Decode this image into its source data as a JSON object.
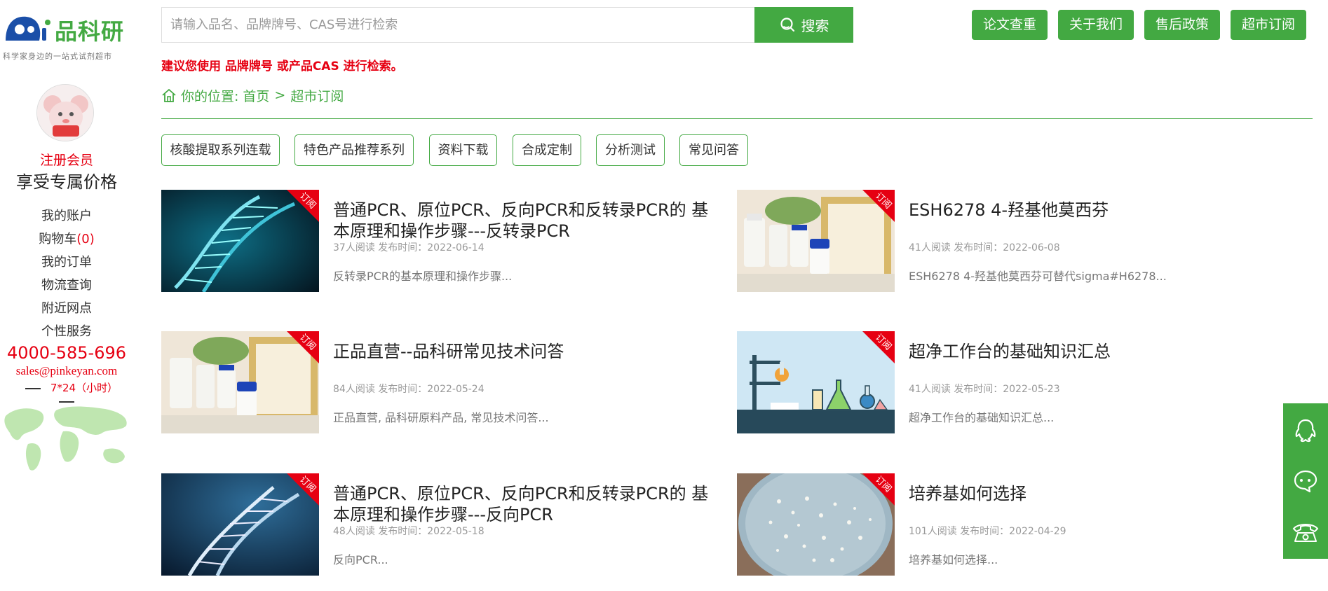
{
  "logo": {
    "text": "品科研",
    "slogan": "科学家身边的一站式试剂超市"
  },
  "sidebar": {
    "register": "注册会员",
    "price_tag": "享受专属价格",
    "menu": {
      "account": "我的账户",
      "cart": "购物车",
      "cart_count": "(0)",
      "orders": "我的订单",
      "logistics": "物流查询",
      "nearby": "附近网点",
      "custom": "个性服务"
    },
    "phone": "4000-585-696",
    "email": "sales@pinkeyan.com",
    "hours": "7*24（小时）"
  },
  "search": {
    "placeholder": "请输入品名、品牌牌号、CAS号进行检索",
    "button": "搜索",
    "tip": "建议您使用 品牌牌号 或产品CAS 进行检索。"
  },
  "top_nav": {
    "paper_check": "论文查重",
    "about": "关于我们",
    "after_sales": "售后政策",
    "subscribe": "超市订阅"
  },
  "breadcrumb": {
    "label": "你的位置:",
    "home": "首页",
    "separator": ">",
    "current": "超市订阅"
  },
  "tags": {
    "t1": "核酸提取系列连载",
    "t2": "特色产品推荐系列",
    "t3": "资料下载",
    "t4": "合成定制",
    "t5": "分析测试",
    "t6": "常见问答"
  },
  "ribbon_label": "订阅",
  "articles": [
    {
      "title": "普通PCR、原位PCR、反向PCR和反转录PCR的 基本原理和操作步骤---反转录PCR",
      "meta": "37人阅读 发布时间：2022-06-14",
      "desc": "反转录PCR的基本原理和操作步骤..."
    },
    {
      "title": "ESH6278 4-羟基他莫西芬",
      "meta": "41人阅读 发布时间：2022-06-08",
      "desc": "ESH6278 4-羟基他莫西芬可替代sigma#H6278..."
    },
    {
      "title": "正品直营--品科研常见技术问答",
      "meta": "84人阅读 发布时间：2022-05-24",
      "desc": "正品直营, 品科研原料产品, 常见技术问答..."
    },
    {
      "title": "超净工作台的基础知识汇总",
      "meta": "41人阅读 发布时间：2022-05-23",
      "desc": "超净工作台的基础知识汇总..."
    },
    {
      "title": "普通PCR、原位PCR、反向PCR和反转录PCR的 基本原理和操作步骤---反向PCR",
      "meta": "48人阅读 发布时间：2022-05-18",
      "desc": "反向PCR..."
    },
    {
      "title": "培养基如何选择",
      "meta": "101人阅读 发布时间：2022-04-29",
      "desc": "培养基如何选择..."
    }
  ],
  "colors": {
    "brand_green": "#43a942",
    "accent_red": "#e60012"
  },
  "icons": {
    "search": "search-icon",
    "home": "home-icon",
    "qq": "qq-icon",
    "wechat": "wechat-icon",
    "phone": "phone-icon"
  }
}
